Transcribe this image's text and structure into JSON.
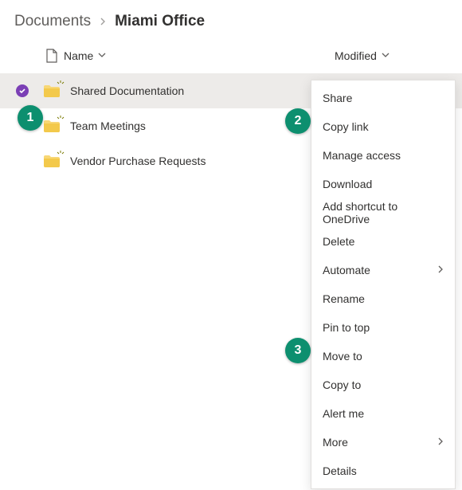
{
  "breadcrumb": {
    "parent": "Documents",
    "current": "Miami Office"
  },
  "columns": {
    "name": "Name",
    "modified": "Modified"
  },
  "rows": [
    {
      "name": "Shared Documentation",
      "selected": true,
      "showActions": true,
      "newMark": true
    },
    {
      "name": "Team Meetings",
      "selected": false,
      "showActions": false,
      "newMark": true
    },
    {
      "name": "Vendor Purchase Requests",
      "selected": false,
      "showActions": false,
      "newMark": true
    }
  ],
  "menu": {
    "items": [
      {
        "label": "Share",
        "submenu": false
      },
      {
        "label": "Copy link",
        "submenu": false
      },
      {
        "label": "Manage access",
        "submenu": false
      },
      {
        "label": "Download",
        "submenu": false
      },
      {
        "label": "Add shortcut to OneDrive",
        "submenu": false
      },
      {
        "label": "Delete",
        "submenu": false
      },
      {
        "label": "Automate",
        "submenu": true
      },
      {
        "label": "Rename",
        "submenu": false
      },
      {
        "label": "Pin to top",
        "submenu": false
      },
      {
        "label": "Move to",
        "submenu": false
      },
      {
        "label": "Copy to",
        "submenu": false
      },
      {
        "label": "Alert me",
        "submenu": false
      },
      {
        "label": "More",
        "submenu": true
      },
      {
        "label": "Details",
        "submenu": false
      }
    ]
  },
  "steps": {
    "s1": "1",
    "s2": "2",
    "s3": "3"
  }
}
